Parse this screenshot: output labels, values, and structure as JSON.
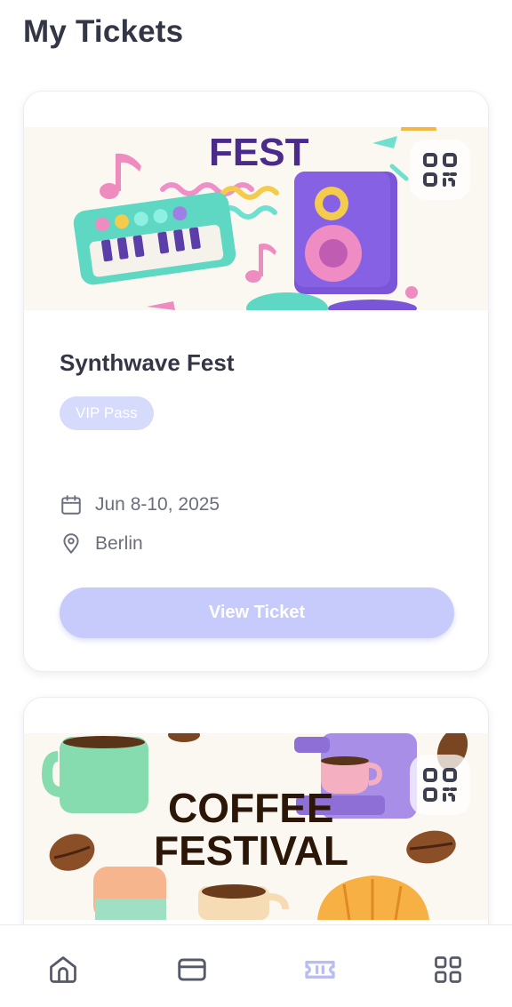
{
  "header": {
    "title": "My Tickets"
  },
  "tickets": [
    {
      "banner_text": "FEST",
      "title": "Synthwave Fest",
      "pass": "VIP Pass",
      "date": "Jun 8-10, 2025",
      "location": "Berlin",
      "button": "View Ticket"
    },
    {
      "banner_text_line1": "COFFEE",
      "banner_text_line2": "FESTIVAL"
    }
  ],
  "nav": {
    "items": [
      "home-icon",
      "card-icon",
      "ticket-icon",
      "grid-icon"
    ],
    "active": "ticket-icon"
  },
  "colors": {
    "accent": "#c6cbfb",
    "badge": "#d6dafb",
    "active_nav": "#b9bdf4",
    "text_primary": "#343645",
    "text_secondary": "#6b6e7b"
  }
}
